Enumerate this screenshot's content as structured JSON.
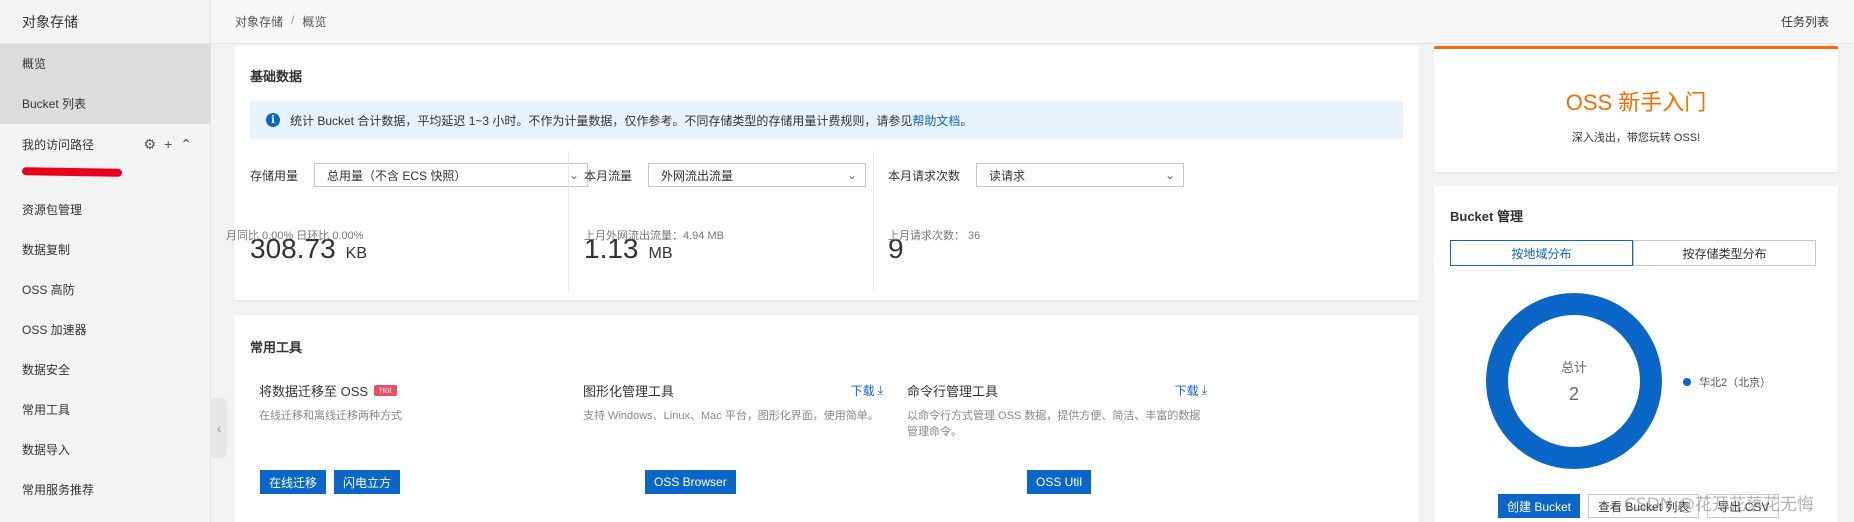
{
  "sidebar": {
    "title": "对象存储",
    "items_top": [
      {
        "label": "概览"
      },
      {
        "label": "Bucket 列表"
      }
    ],
    "group": {
      "label": "我的访问路径"
    },
    "items": [
      {
        "label": "资源包管理"
      },
      {
        "label": "数据复制"
      },
      {
        "label": "OSS 高防"
      },
      {
        "label": "OSS 加速器"
      },
      {
        "label": "数据安全"
      },
      {
        "label": "常用工具"
      },
      {
        "label": "数据导入"
      },
      {
        "label": "常用服务推荐"
      }
    ]
  },
  "topbar": {
    "breadcrumb": [
      "对象存储",
      "/",
      "概览"
    ],
    "task_list": "任务列表"
  },
  "basic": {
    "title": "基础数据",
    "notice": "统计 Bucket 合计数据，平均延迟 1~3 小时。不作为计量数据，仅作参考。不同存储类型的存储用量计费规则，请参见",
    "notice_link": "帮助文档",
    "notice_end": "。",
    "metrics": [
      {
        "label": "存储用量",
        "select": "总用量（不含 ECS 快照）",
        "value": "308.73",
        "unit": "KB",
        "sub": "月同比  0.00%   日环比  0.00%"
      },
      {
        "label": "本月流量",
        "select": "外网流出流量",
        "value": "1.13",
        "unit": "MB",
        "sub": "上月外网流出流量：4.94 MB"
      },
      {
        "label": "本月请求次数",
        "select": "读请求",
        "value": "9",
        "unit": "",
        "sub": "上月请求次数：  36"
      }
    ]
  },
  "tools": {
    "title": "常用工具",
    "items": [
      {
        "name": "将数据迁移至 OSS",
        "hot": "Hot",
        "download": "",
        "desc": "在线迁移和离线迁移两种方式",
        "buttons": [
          "在线迁移",
          "闪电立方"
        ]
      },
      {
        "name": "图形化管理工具",
        "hot": "",
        "download": "下载",
        "desc": "支持 Windows、Linux、Mac 平台，图形化界面，使用简单。",
        "buttons": [
          "OSS Browser"
        ]
      },
      {
        "name": "命令行管理工具",
        "hot": "",
        "download": "下载",
        "desc": "以命令行方式管理 OSS 数据，提供方便、简洁、丰富的数据管理命令。",
        "buttons": [
          "OSS Util"
        ]
      }
    ]
  },
  "intro": {
    "title": "OSS 新手入门",
    "subtitle": "深入浅出，带您玩转 OSS!"
  },
  "bucket": {
    "title": "Bucket 管理",
    "tabs": [
      "按地域分布",
      "按存储类型分布"
    ],
    "center_label": "总计",
    "center_value": "2",
    "legend": "华北2（北京）",
    "buttons": [
      "创建 Bucket",
      "查看 Bucket 列表",
      "导出 CSV"
    ]
  },
  "watermark": "CSDN @花开花落花无悔",
  "colors": {
    "accent": "#0a67c8",
    "brand": "#ff6a00",
    "hot": "#f04a65",
    "redaction": "#e8001c"
  }
}
